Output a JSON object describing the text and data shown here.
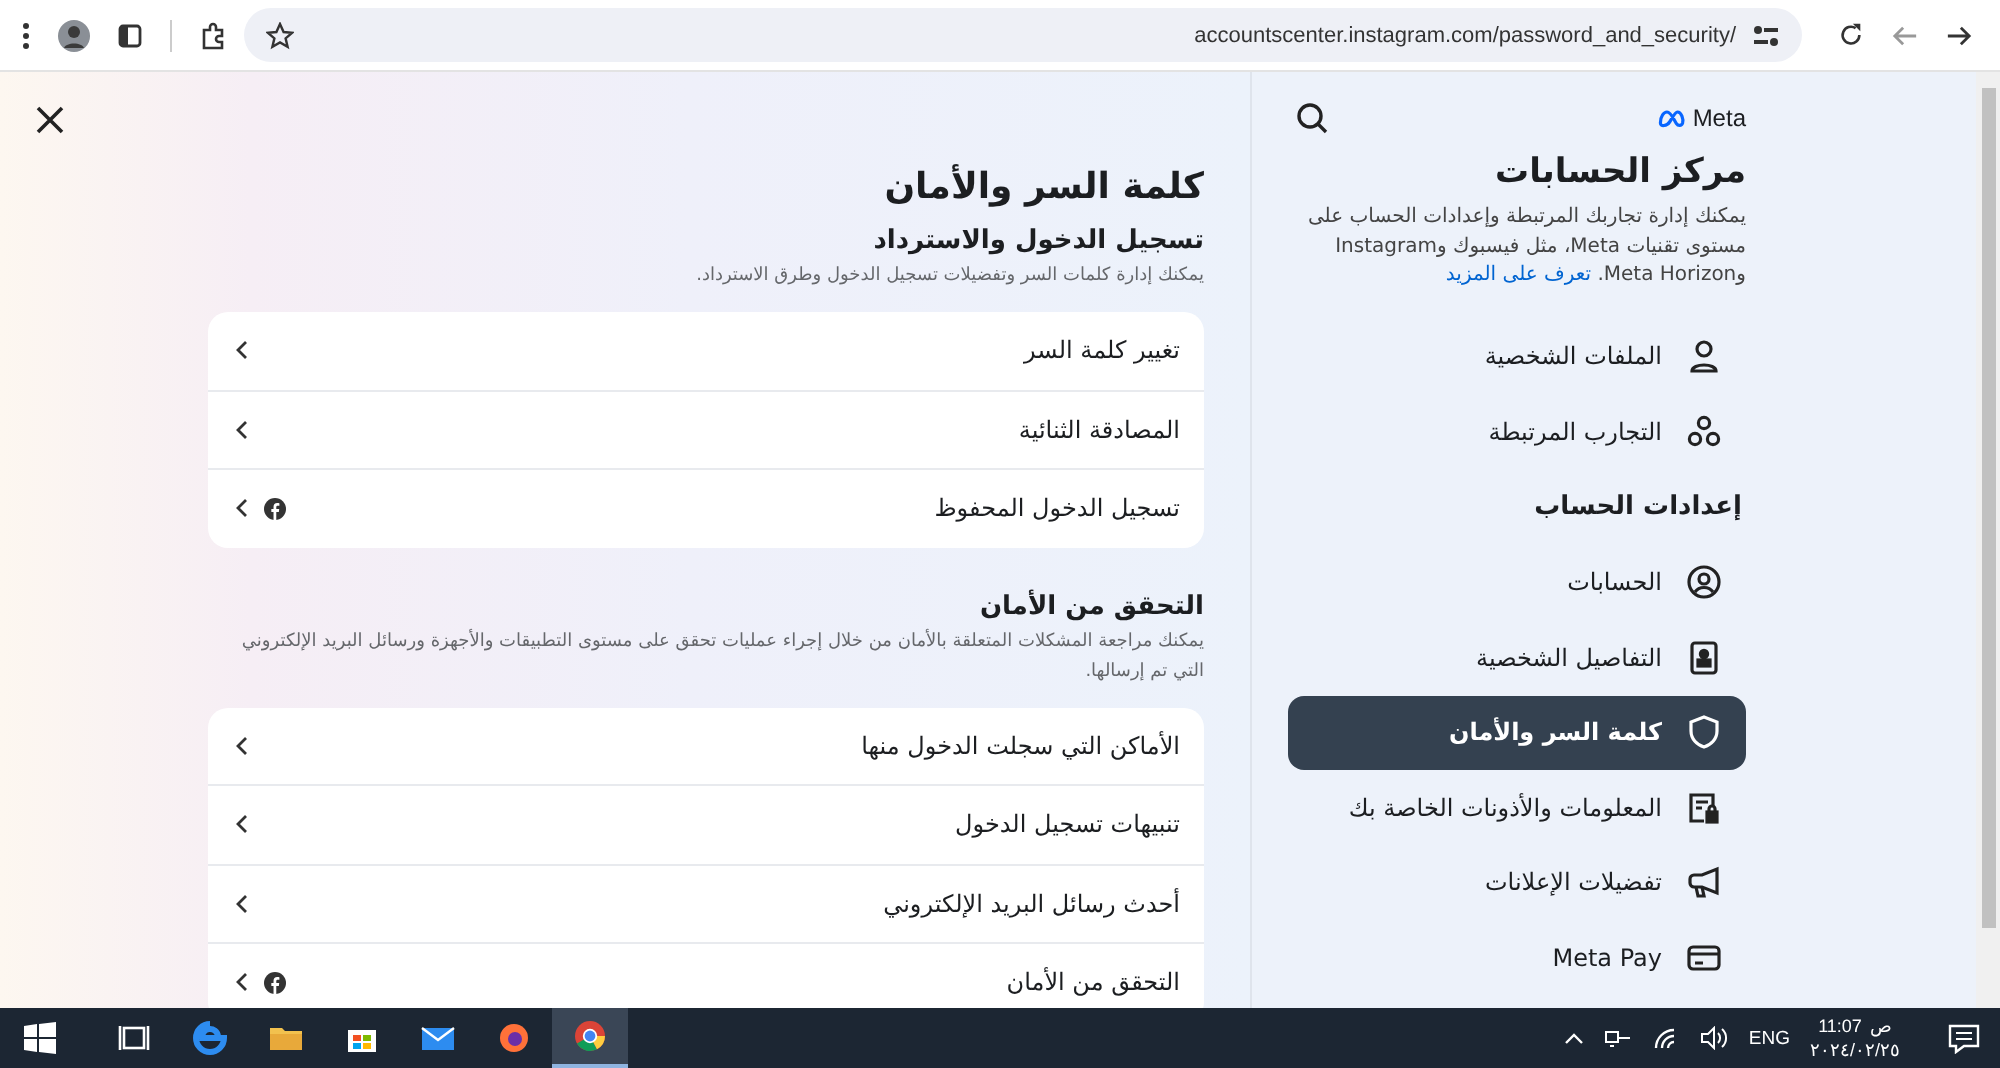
{
  "browser": {
    "url": "accountscenter.instagram.com/password_and_security/"
  },
  "page": {
    "title": "كلمة السر والأمان",
    "sections": [
      {
        "heading": "تسجيل الدخول والاسترداد",
        "description": "يمكنك إدارة كلمات السر وتفضيلات تسجيل الدخول وطرق الاسترداد.",
        "rows": [
          {
            "label": "تغيير كلمة السر",
            "kind": "plain"
          },
          {
            "label": "المصادقة الثنائية",
            "kind": "plain"
          },
          {
            "label": "تسجيل الدخول المحفوظ",
            "kind": "facebook"
          }
        ]
      },
      {
        "heading": "التحقق من الأمان",
        "description": "يمكنك مراجعة المشكلات المتعلقة بالأمان من خلال إجراء عمليات تحقق على مستوى التطبيقات والأجهزة ورسائل البريد الإلكتروني التي تم إرسالها.",
        "rows": [
          {
            "label": "الأماكن التي سجلت الدخول منها",
            "kind": "plain"
          },
          {
            "label": "تنبيهات تسجيل الدخول",
            "kind": "plain"
          },
          {
            "label": "أحدث رسائل البريد الإلكتروني",
            "kind": "plain"
          },
          {
            "label": "التحقق من الأمان",
            "kind": "facebook"
          }
        ]
      }
    ]
  },
  "sidebar": {
    "brand": "Meta",
    "title": "مركز الحسابات",
    "description": "يمكنك إدارة تجاربك المرتبطة وإعدادات الحساب على مستوى تقنيات Meta، مثل فيسبوك وInstagram وMeta Horizon.",
    "link": "تعرف على المزيد",
    "items": [
      {
        "kind": "item",
        "label": "الملفات الشخصية",
        "selected": false
      },
      {
        "kind": "item",
        "label": "التجارب المرتبطة",
        "selected": false
      },
      {
        "kind": "header",
        "label": "إعدادات الحساب"
      },
      {
        "kind": "item",
        "label": "الحسابات",
        "selected": false
      },
      {
        "kind": "item",
        "label": "التفاصيل الشخصية",
        "selected": false
      },
      {
        "kind": "item",
        "label": "كلمة السر والأمان",
        "selected": true
      },
      {
        "kind": "item",
        "label": "المعلومات والأذونات الخاصة بك",
        "selected": false
      },
      {
        "kind": "item",
        "label": "تفضيلات الإعلانات",
        "selected": false
      },
      {
        "kind": "item",
        "label": "Meta Pay",
        "selected": false
      }
    ]
  },
  "taskbar": {
    "apps": [
      {
        "selected": false
      },
      {
        "selected": false
      },
      {
        "selected": false
      },
      {
        "selected": false
      },
      {
        "selected": false
      },
      {
        "selected": false
      },
      {
        "selected": true
      }
    ],
    "language": "ENG",
    "time": "11:07",
    "ampm": "ص",
    "date": "٢٠٢٤/٠٢/٢٥"
  }
}
